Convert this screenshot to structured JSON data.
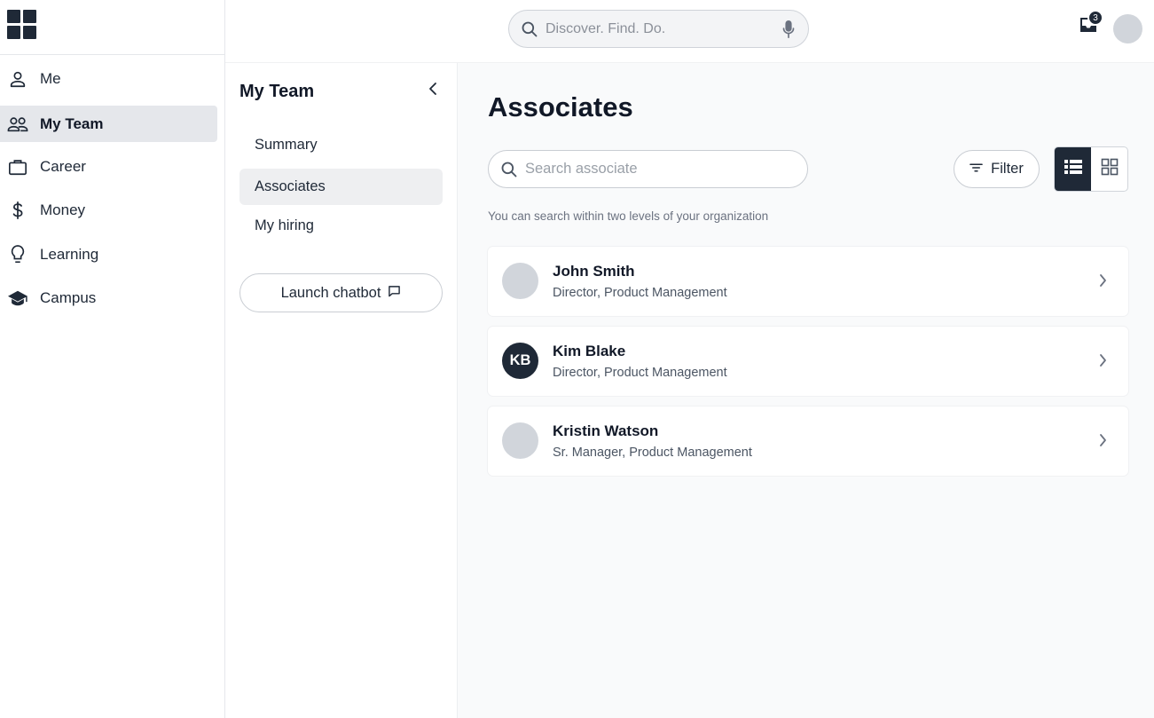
{
  "header": {
    "search_placeholder": "Discover. Find. Do.",
    "notification_count": "3"
  },
  "sidebar": {
    "items": [
      {
        "label": "Me",
        "icon": "person-icon",
        "active": false
      },
      {
        "label": "My Team",
        "icon": "team-icon",
        "active": true
      },
      {
        "label": "Career",
        "icon": "briefcase-icon",
        "active": false
      },
      {
        "label": "Money",
        "icon": "dollar-icon",
        "active": false
      },
      {
        "label": "Learning",
        "icon": "lightbulb-icon",
        "active": false
      },
      {
        "label": "Campus",
        "icon": "graduation-cap-icon",
        "active": false
      }
    ]
  },
  "subnav": {
    "title": "My Team",
    "items": [
      {
        "label": "Summary",
        "active": false
      },
      {
        "label": "Associates",
        "active": true
      },
      {
        "label": "My hiring",
        "active": false
      }
    ],
    "chatbot_label": "Launch chatbot"
  },
  "main": {
    "title": "Associates",
    "search_placeholder": "Search associate",
    "filter_label": "Filter",
    "view_mode": "list",
    "hint": "You can search within two levels of your organization",
    "associates": [
      {
        "name": "John Smith",
        "role": "Director, Product Management",
        "initials": ""
      },
      {
        "name": "Kim Blake",
        "role": "Director, Product Management",
        "initials": "KB"
      },
      {
        "name": "Kristin Watson",
        "role": "Sr. Manager, Product Management",
        "initials": ""
      }
    ]
  },
  "colors": {
    "primary_dark": "#1f2937",
    "background": "#f9fafb",
    "active_nav": "#e5e7eb"
  }
}
